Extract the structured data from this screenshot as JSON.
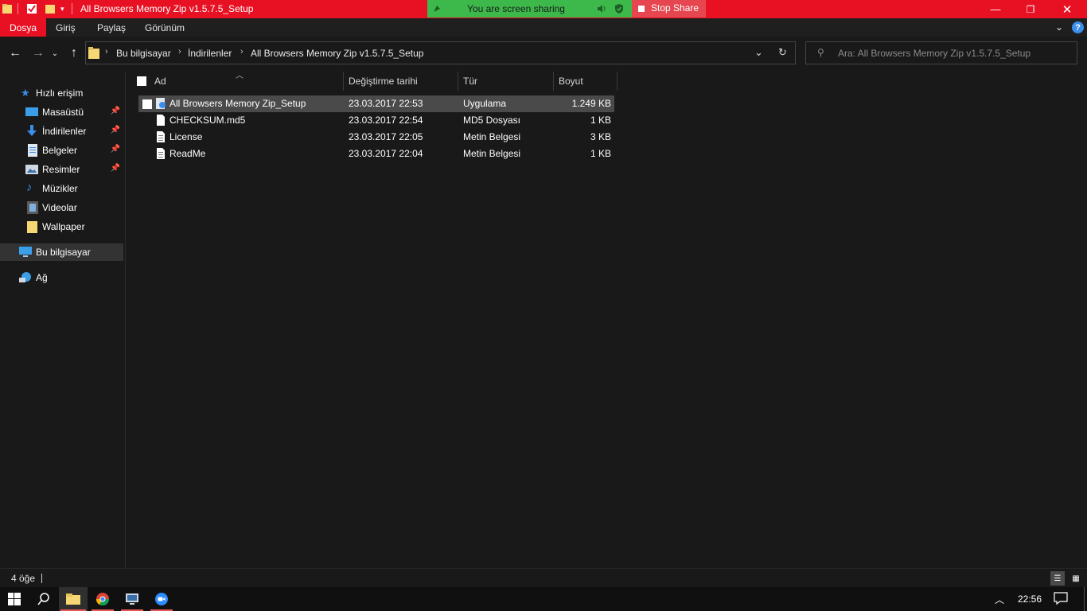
{
  "window": {
    "title": "All Browsers Memory Zip v1.5.7.5_Setup"
  },
  "share": {
    "banner_text": "You are screen sharing",
    "stop_label": "Stop Share"
  },
  "ribbon": {
    "tabs": [
      "Dosya",
      "Giriş",
      "Paylaş",
      "Görünüm"
    ]
  },
  "address": {
    "crumbs": [
      "Bu bilgisayar",
      "İndirilenler",
      "All Browsers Memory Zip v1.5.7.5_Setup"
    ]
  },
  "search": {
    "placeholder": "Ara: All Browsers Memory Zip v1.5.7.5_Setup"
  },
  "sidebar": {
    "quick_access": "Hızlı erişim",
    "items": [
      {
        "label": "Masaüstü",
        "icon": "desktop-icon",
        "pinned": true
      },
      {
        "label": "İndirilenler",
        "icon": "download-icon",
        "pinned": true
      },
      {
        "label": "Belgeler",
        "icon": "documents-icon",
        "pinned": true
      },
      {
        "label": "Resimler",
        "icon": "pictures-icon",
        "pinned": true
      },
      {
        "label": "Müzikler",
        "icon": "music-icon",
        "pinned": false
      },
      {
        "label": "Videolar",
        "icon": "videos-icon",
        "pinned": false
      },
      {
        "label": "Wallpaper",
        "icon": "folder-icon",
        "pinned": false
      }
    ],
    "this_pc": "Bu bilgisayar",
    "network": "Ağ"
  },
  "columns": [
    "Ad",
    "Değiştirme tarihi",
    "Tür",
    "Boyut"
  ],
  "files": [
    {
      "name": "All Browsers Memory Zip_Setup",
      "date": "23.03.2017 22:53",
      "type": "Uygulama",
      "size": "1.249 KB",
      "icon": "installer-icon"
    },
    {
      "name": "CHECKSUM.md5",
      "date": "23.03.2017 22:54",
      "type": "MD5 Dosyası",
      "size": "1 KB",
      "icon": "file-icon"
    },
    {
      "name": "License",
      "date": "23.03.2017 22:05",
      "type": "Metin Belgesi",
      "size": "3 KB",
      "icon": "text-file-icon"
    },
    {
      "name": "ReadMe",
      "date": "23.03.2017 22:04",
      "type": "Metin Belgesi",
      "size": "1 KB",
      "icon": "text-file-icon"
    }
  ],
  "status": {
    "count": "4 öğe"
  },
  "taskbar": {
    "clock": "22:56"
  },
  "colors": {
    "accent": "#e81123",
    "share_green": "#3cb94a",
    "stop_red": "#e5464f",
    "background": "#191919"
  }
}
